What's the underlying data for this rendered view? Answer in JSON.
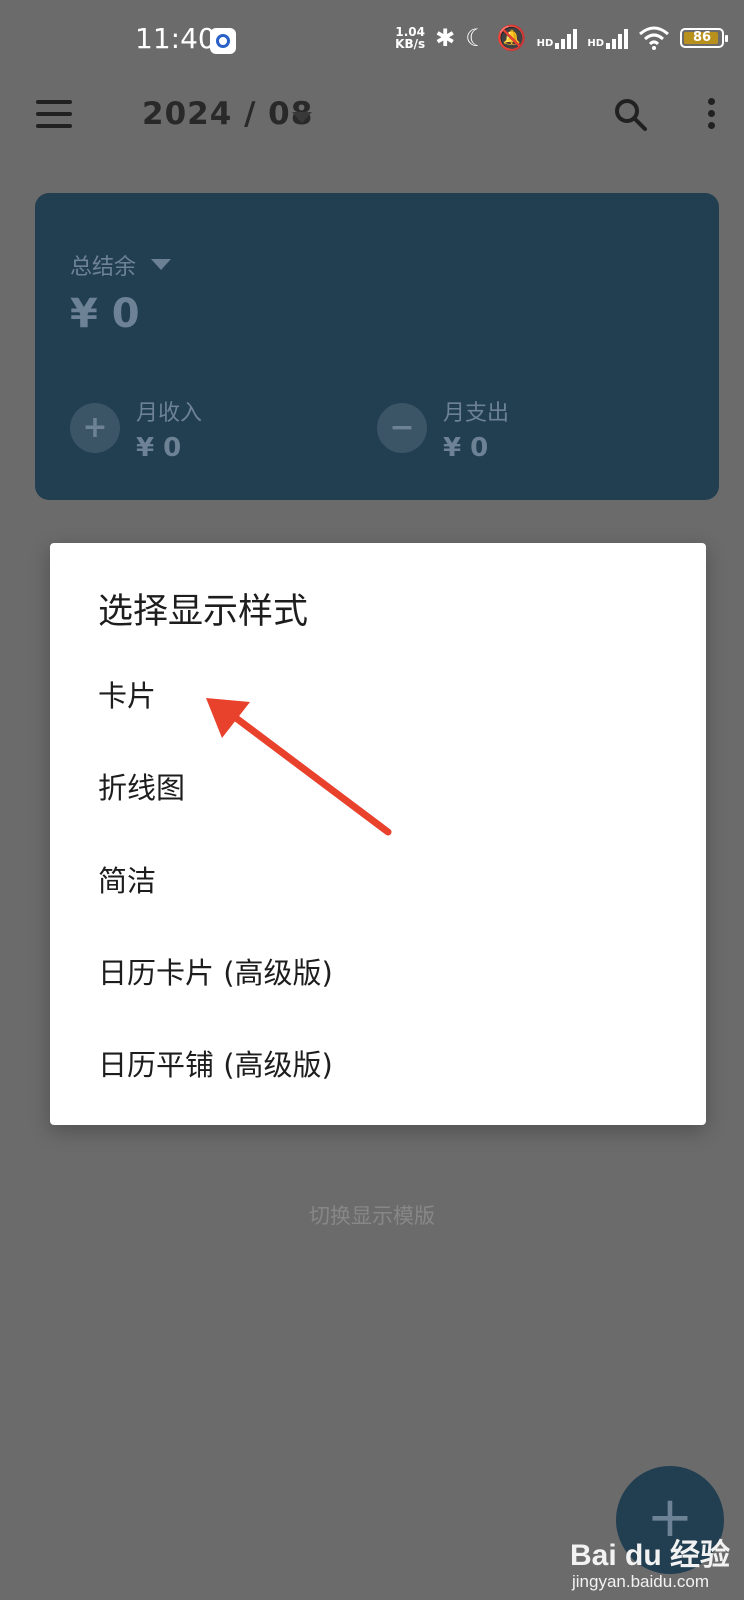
{
  "status_bar": {
    "time": "11:40",
    "net_speed_value": "1.04",
    "net_speed_unit": "KB/s",
    "hd1": "HD",
    "hd2": "HD",
    "battery": "86"
  },
  "app_bar": {
    "month": "2024 / 08"
  },
  "summary_card": {
    "balance_label": "总结余",
    "balance_value": "¥ 0",
    "income_label": "月收入",
    "income_value": "¥ 0",
    "expense_label": "月支出",
    "expense_value": "¥ 0",
    "income_icon": "+",
    "expense_icon": "−"
  },
  "dialog": {
    "title": "选择显示样式",
    "options": [
      "卡片",
      "折线图",
      "简洁",
      "日历卡片 (高级版)",
      "日历平铺 (高级版)"
    ]
  },
  "background": {
    "switch_template": "切换显示模版",
    "fab_icon": "+"
  },
  "watermark": {
    "logo": "Bai du 经验",
    "url": "jingyan.baidu.com"
  },
  "colors": {
    "annotation_arrow": "#e8412c",
    "card_bg": "#233f53",
    "scrim": "#6b6b6b"
  }
}
